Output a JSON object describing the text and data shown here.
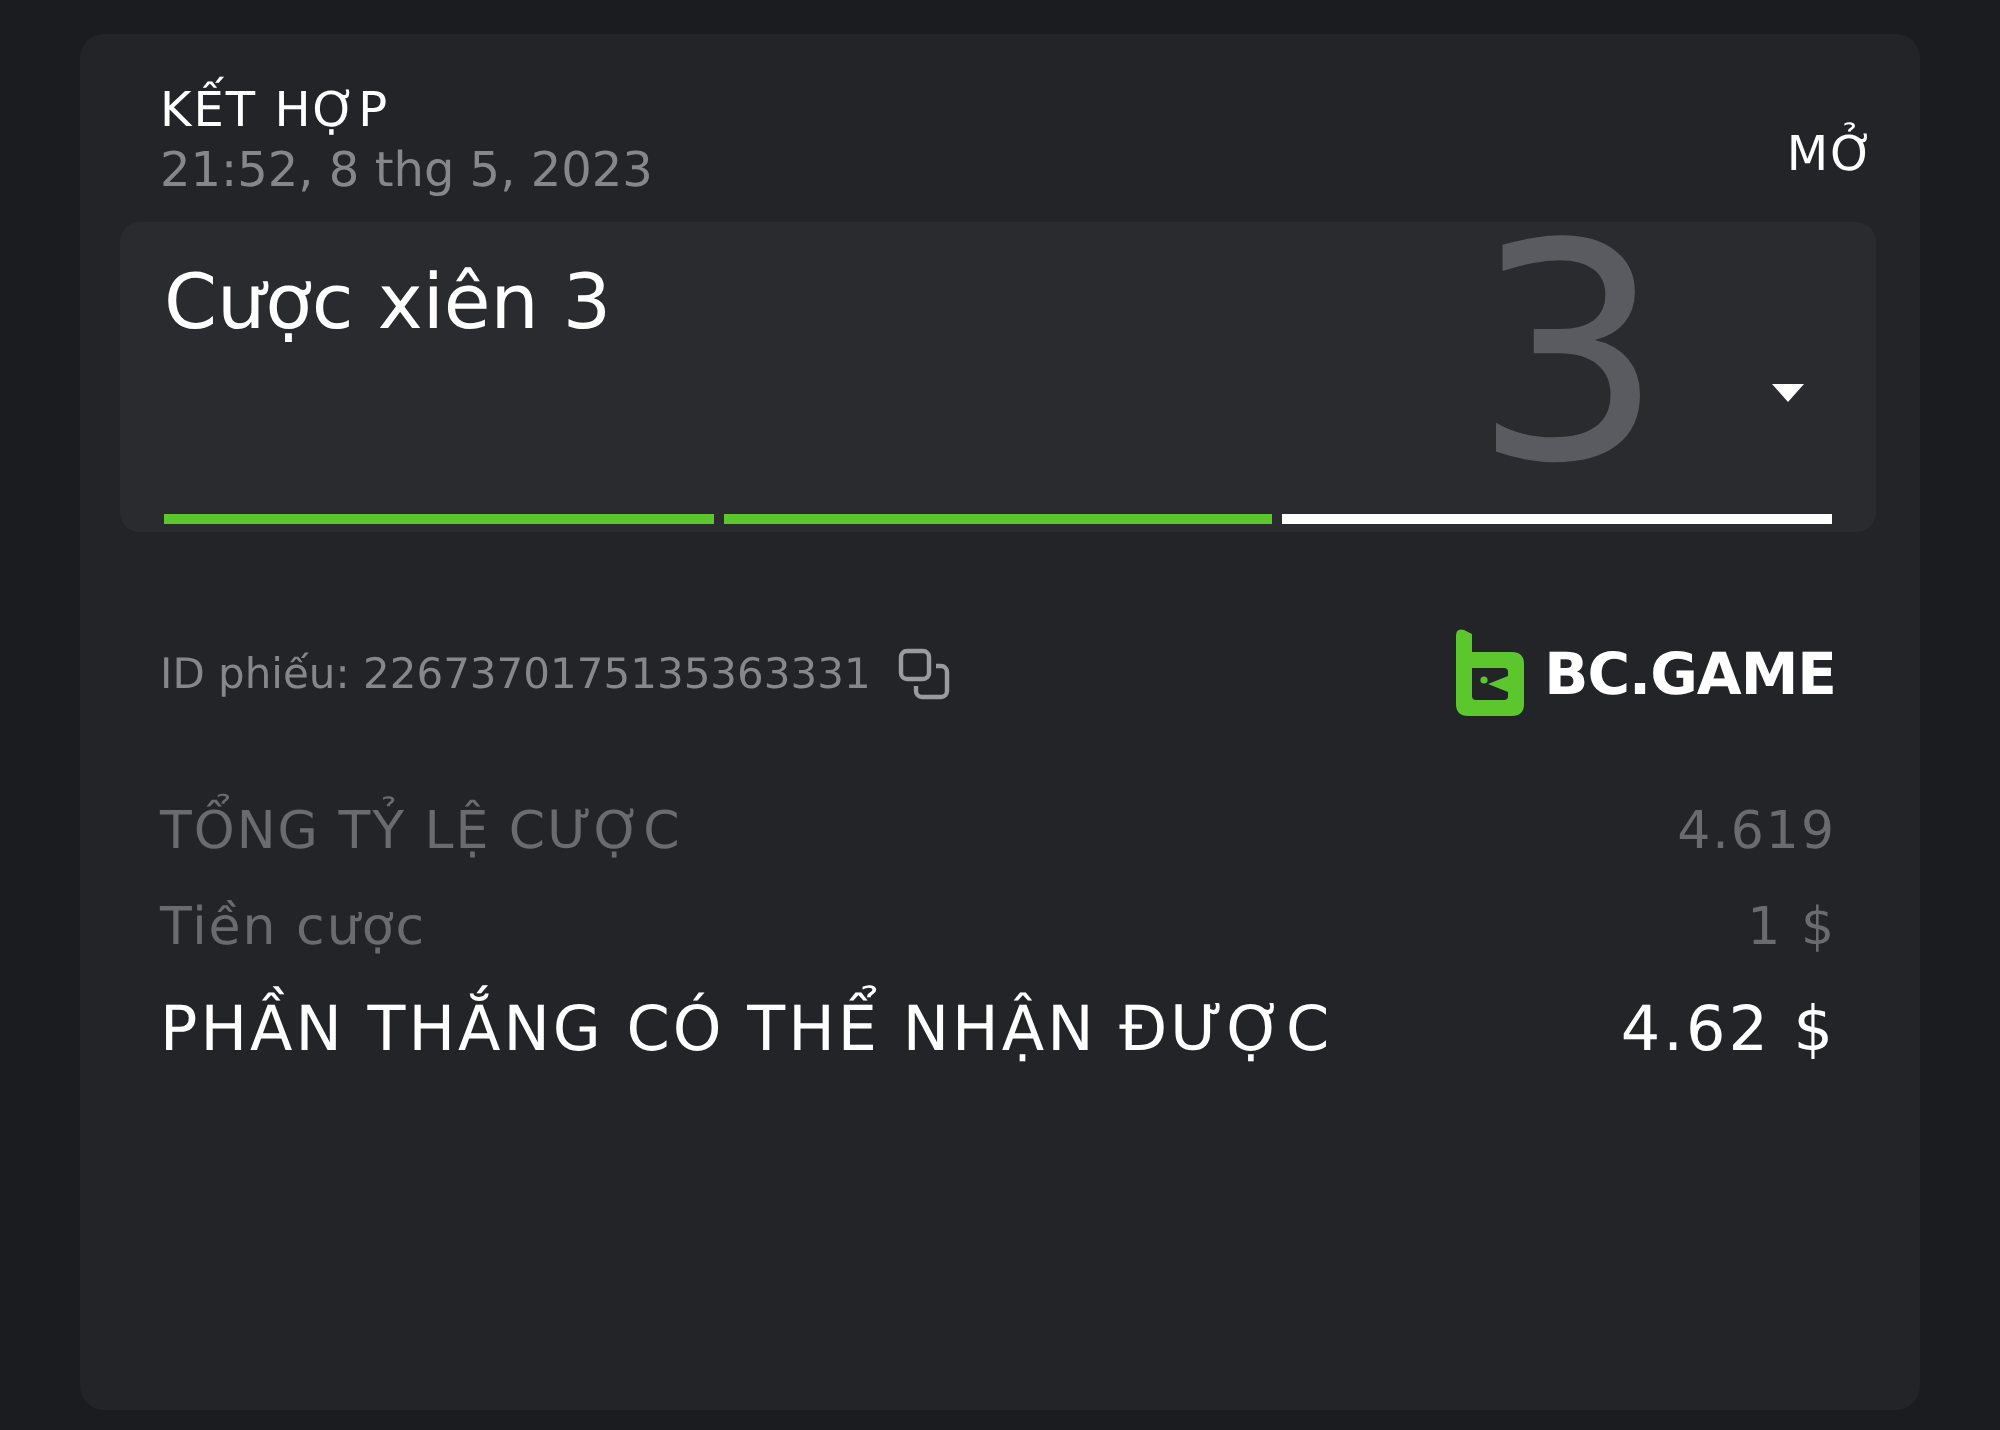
{
  "header": {
    "title": "KẾT HỢP",
    "datetime": "21:52, 8 thg 5, 2023",
    "status": "MỞ"
  },
  "bet": {
    "title": "Cược xiên 3",
    "big_number": "3",
    "expanded": false,
    "segments": [
      {
        "color": "#5cc62d"
      },
      {
        "color": "#5cc62d"
      },
      {
        "color": "#ffffff"
      }
    ]
  },
  "ticket": {
    "id_label": "ID phiếu: 2267370175135363331",
    "brand": "BC.GAME"
  },
  "summary": [
    {
      "kind": "muted",
      "label": "TỔNG TỶ LỆ CƯỢC",
      "value": "4.619"
    },
    {
      "kind": "muted",
      "label": "Tiền cược",
      "value": "1 $"
    },
    {
      "kind": "total",
      "label": "PHẦN THẮNG CÓ THỂ NHẬN ĐƯỢC",
      "value": "4.62 $"
    }
  ]
}
